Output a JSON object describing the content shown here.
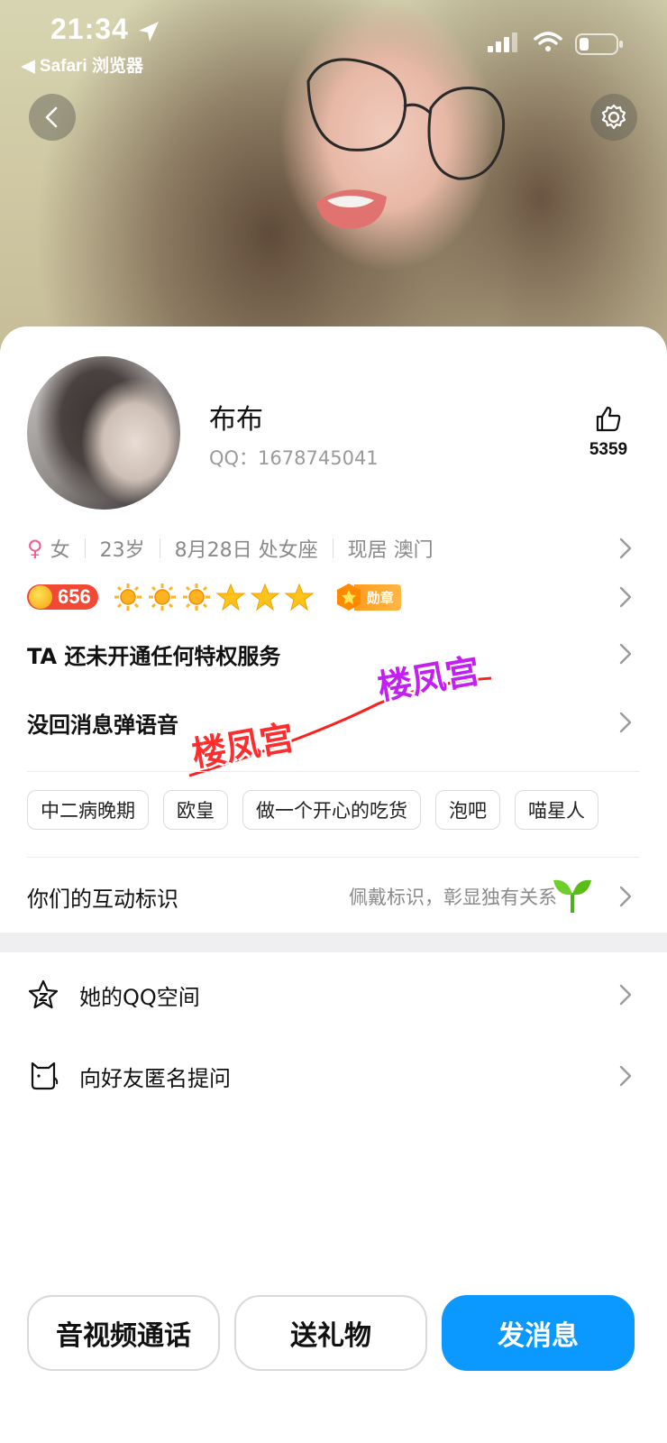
{
  "status_bar": {
    "time": "21:34",
    "back_app": "◀ Safari 浏览器"
  },
  "profile": {
    "nickname": "布布",
    "qq_label": "QQ：1678745041",
    "likes": "5359"
  },
  "info": {
    "gender_symbol": "♀",
    "gender": "女",
    "age": "23岁",
    "birthday": "8月28日 处女座",
    "location": "现居 澳门"
  },
  "badges": {
    "level": "656",
    "medal_label": "勋章",
    "icons": [
      "sun-icon",
      "sun-icon",
      "sun-icon",
      "star-icon",
      "star-icon",
      "star-icon"
    ]
  },
  "rows": {
    "privilege": "TA 还未开通任何特权服务",
    "voice": "没回消息弹语音"
  },
  "tags": [
    "中二病晚期",
    "欧皇",
    "做一个开心的吃货",
    "泡吧",
    "喵星人"
  ],
  "interaction": {
    "label": "你们的互动标识",
    "hint": "佩戴标识，彰显独有关系"
  },
  "list": [
    {
      "label": "她的QQ空间",
      "icon": "star-icon"
    },
    {
      "label": "向好友匿名提问",
      "icon": "cat-icon"
    }
  ],
  "buttons": {
    "call": "音视频通话",
    "gift": "送礼物",
    "message": "发消息"
  },
  "watermark": "楼凤宫",
  "colors": {
    "primary": "#0b99ff",
    "level_badge": "#f04a36",
    "medal": "#ff9c1e"
  }
}
